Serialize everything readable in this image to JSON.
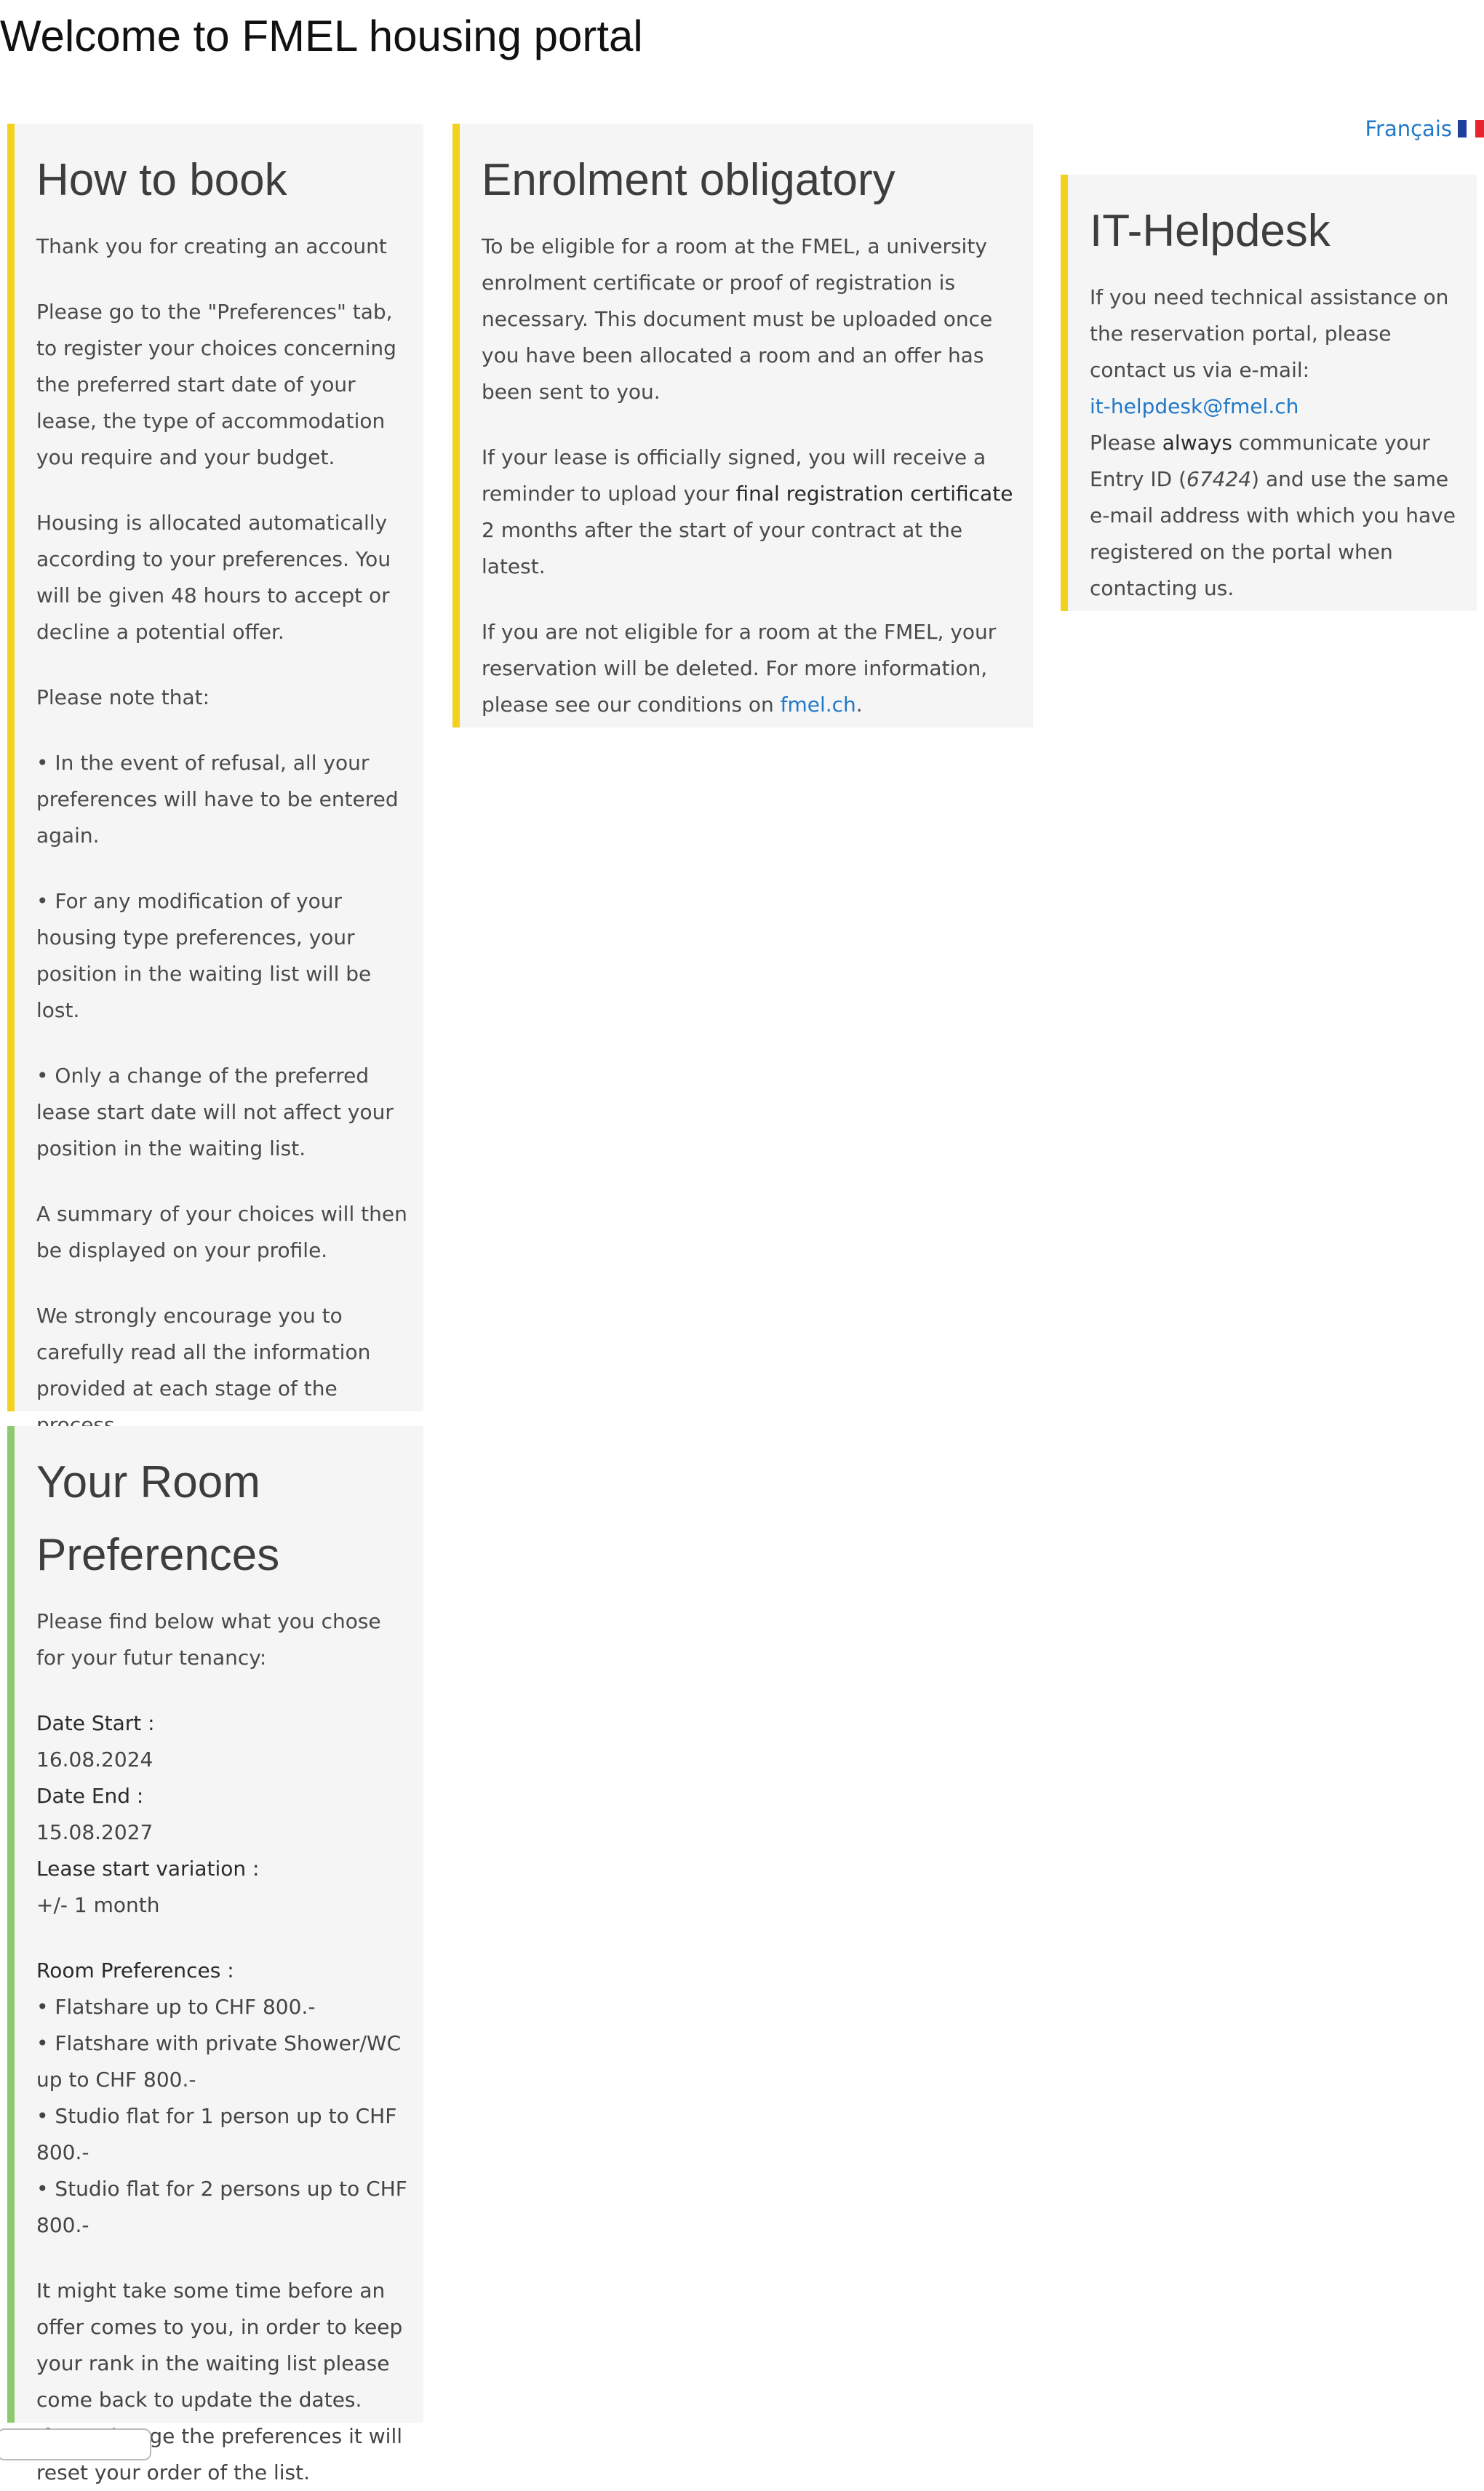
{
  "page": {
    "title": "Welcome to FMEL housing portal"
  },
  "language": {
    "label": "Français"
  },
  "how_to_book": {
    "title": "How to book",
    "intro": "Thank you for creating an account",
    "p1": "Please go to the \"Preferences\" tab, to register your choices concerning the preferred start date of your lease, the type of accommodation you require and your budget.",
    "p2": "Housing is allocated automatically according to your preferences. You will be given 48 hours to accept or decline a potential offer.",
    "note_heading": "Please note that:",
    "bullet1": "• In the event of refusal, all your preferences will have to be entered again.",
    "bullet2": "• For any modification of your housing type preferences, your position in the waiting list will be lost.",
    "bullet3": "• Only a change of the preferred lease start date will not affect your position in the waiting list.",
    "p3": "A summary of your choices will then be displayed on your profile.",
    "p4": "We strongly encourage you to carefully read all the information provided at each stage of the process."
  },
  "enrolment": {
    "title": "Enrolment obligatory",
    "p1": "To be eligible for a room at the FMEL, a university enrolment certificate or proof of registration is necessary. This document must be uploaded once you have been allocated a room and an offer has been sent to you.",
    "p2_before": "If your lease is officially signed, you will receive a reminder to upload your ",
    "p2_bold": "final registration certificate",
    "p2_after": " 2 months after the start of your contract at the latest.",
    "p3_before": "If you are not eligible for a room at the FMEL, your reservation will be deleted. For more information, please see our conditions on ",
    "p3_link": "fmel.ch",
    "p3_after": "."
  },
  "helpdesk": {
    "title": "IT-Helpdesk",
    "p1": "If you need technical assistance on the reservation portal, please contact us via e-mail:",
    "email": "it-helpdesk@fmel.ch",
    "p2_before": "Please ",
    "p2_bold": "always",
    "p2_mid": " communicate your Entry ID (",
    "entry_id": "67424",
    "p2_after": ") and use the same e-mail address with which you have registered on the portal when contacting us."
  },
  "room_prefs": {
    "title": "Your Room Preferences",
    "intro": "Please find below what you chose for your futur tenancy:",
    "date_start_label": "Date Start :",
    "date_start": " 16.08.2024",
    "date_end_label": "Date End :",
    "date_end": " 15.08.2027",
    "variation_label": "Lease start variation :",
    "variation": " +/- 1 month",
    "prefs_heading": "Room Preferences :",
    "prefs": [
      "• Flatshare up to CHF 800.-",
      "• Flatshare with private Shower/WC up to CHF 800.-",
      "• Studio flat for 1 person up to CHF 800.-",
      "• Studio flat for 2 persons up to CHF 800.-"
    ],
    "outro1": "It might take some time before an offer comes to you, in order to keep your rank in the waiting list please come back to update the dates.",
    "outro2": "If you change the preferences it will reset your order of the list."
  },
  "colors": {
    "accent_yellow": "#f2d21f",
    "accent_green": "#8dc96e",
    "link": "#1f78c8",
    "card_bg": "#f5f5f5"
  }
}
